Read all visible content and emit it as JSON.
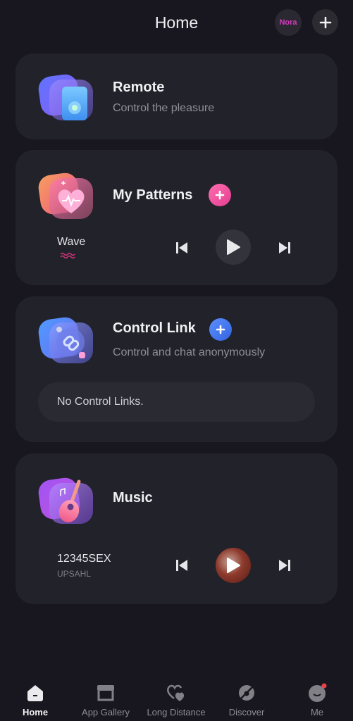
{
  "header": {
    "title": "Home",
    "user_badge": "Nora",
    "add_icon": "plus-icon"
  },
  "cards": {
    "remote": {
      "title": "Remote",
      "subtitle": "Control the pleasure",
      "icon": "remote-phone-icon"
    },
    "patterns": {
      "title": "My Patterns",
      "icon": "heart-pulse-icon",
      "current_pattern": "Wave",
      "pattern_glyph": "wave-icon"
    },
    "control_link": {
      "title": "Control Link",
      "subtitle": "Control and chat anonymously",
      "icon": "link-icon",
      "empty_text": "No Control Links."
    },
    "music": {
      "title": "Music",
      "icon": "guitar-icon",
      "track_title": "12345SEX",
      "track_artist": "UPSAHL"
    }
  },
  "colors": {
    "pink_accent": "#f04e9e",
    "blue_accent": "#3f74ef",
    "nora_text": "#d43bc0",
    "notification_dot": "#e8414a"
  },
  "tabbar": {
    "items": [
      {
        "label": "Home",
        "icon": "home-icon",
        "active": true
      },
      {
        "label": "App Gallery",
        "icon": "store-icon",
        "active": false
      },
      {
        "label": "Long Distance",
        "icon": "hearts-icon",
        "active": false
      },
      {
        "label": "Discover",
        "icon": "planet-icon",
        "active": false
      },
      {
        "label": "Me",
        "icon": "profile-face-icon",
        "active": false,
        "has_notification": true
      }
    ]
  }
}
